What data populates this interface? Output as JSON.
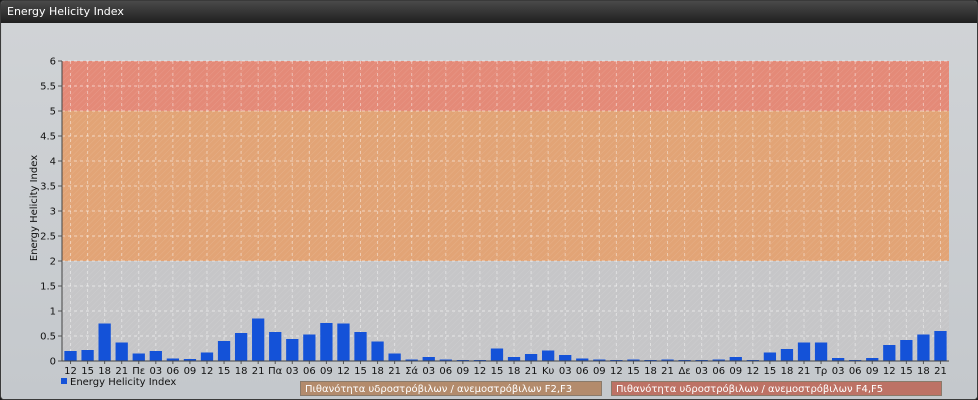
{
  "window": {
    "title": "Energy Helicity Index"
  },
  "colors": {
    "bar": "#1452d8",
    "zone_f4f5": "#e48a78",
    "zone_f2f3": "#e2a476",
    "zone_low": "#c6c6c8",
    "zone_f2f3_box": "#b38b6c",
    "zone_f4f5_box": "#bd7265"
  },
  "zones": {
    "f2f3": {
      "label": "Πιθανότητα υδροστρόβιλων / ανεμοστρόβιλων F2,F3",
      "from": 2,
      "to": 5
    },
    "f4f5": {
      "label": "Πιθανότητα υδροστρόβιλων / ανεμοστρόβιλων F4,F5",
      "from": 5,
      "to": 6
    }
  },
  "chart_data": {
    "type": "bar",
    "title": "",
    "xlabel": "",
    "ylabel": "Energy Helicity Index",
    "ylim": [
      0,
      6
    ],
    "yticks": [
      0,
      0.5,
      1,
      1.5,
      2,
      2.5,
      3,
      3.5,
      4,
      4.5,
      5,
      5.5,
      6
    ],
    "grid": true,
    "legend_position": "bottom-left",
    "categories": [
      "12",
      "15",
      "18",
      "21",
      "Πε",
      "03",
      "06",
      "09",
      "12",
      "15",
      "18",
      "21",
      "Πα",
      "03",
      "06",
      "09",
      "12",
      "15",
      "18",
      "21",
      "Σά",
      "03",
      "06",
      "09",
      "12",
      "15",
      "18",
      "21",
      "Κυ",
      "03",
      "06",
      "09",
      "12",
      "15",
      "18",
      "21",
      "Δε",
      "03",
      "06",
      "09",
      "12",
      "15",
      "18",
      "21",
      "Τρ",
      "03",
      "06",
      "09",
      "12",
      "15",
      "18",
      "21"
    ],
    "series": [
      {
        "name": "Energy Helicity Index",
        "values": [
          0.2,
          0.22,
          0.75,
          0.37,
          0.15,
          0.2,
          0.05,
          0.04,
          0.17,
          0.4,
          0.56,
          0.85,
          0.58,
          0.44,
          0.53,
          0.76,
          0.75,
          0.58,
          0.39,
          0.15,
          0.03,
          0.08,
          0.03,
          0.02,
          0.02,
          0.25,
          0.08,
          0.14,
          0.21,
          0.12,
          0.05,
          0.03,
          0.02,
          0.03,
          0.02,
          0.03,
          0.02,
          0.02,
          0.03,
          0.08,
          0.02,
          0.17,
          0.24,
          0.37,
          0.37,
          0.06,
          0.02,
          0.06,
          0.32,
          0.42,
          0.53,
          0.6
        ]
      }
    ]
  }
}
